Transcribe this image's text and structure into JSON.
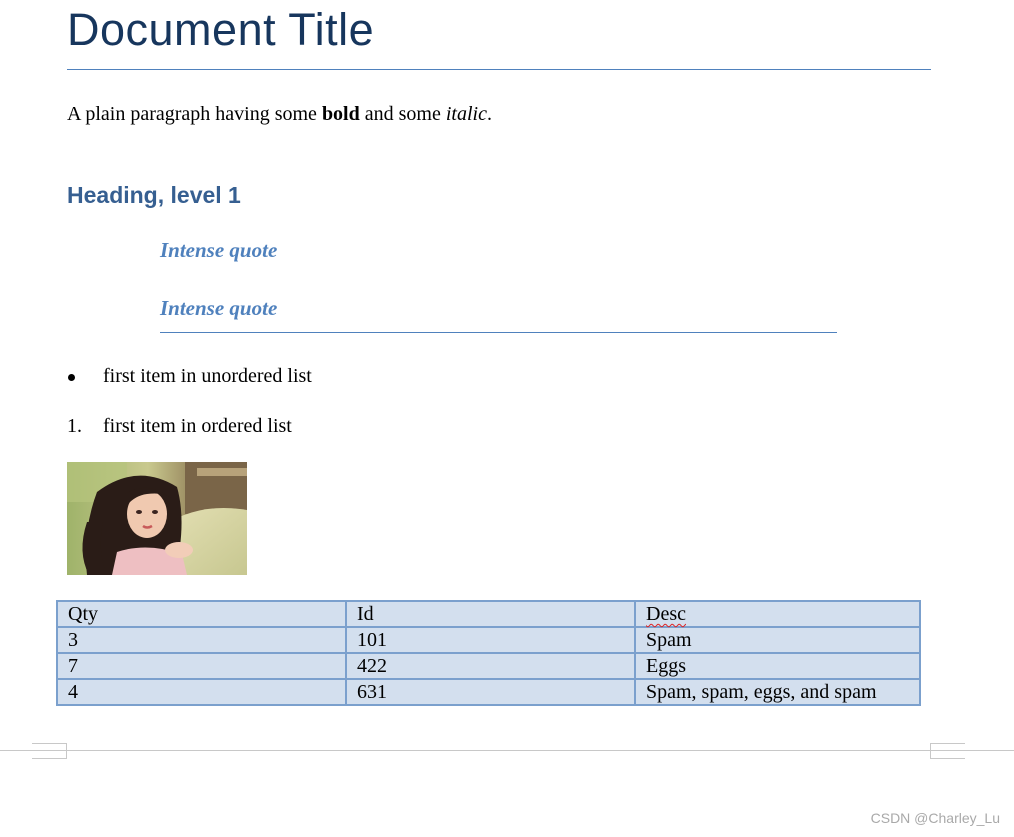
{
  "document": {
    "title": "Document Title",
    "paragraph": {
      "plain": "A plain paragraph having some ",
      "bold": "bold",
      "middle": " and some ",
      "italic": "italic",
      "end": "."
    },
    "heading1": "Heading, level 1",
    "intense_quotes": [
      "Intense quote",
      "Intense quote"
    ],
    "unordered_list": [
      {
        "marker": "bullet",
        "text": "first item in unordered list"
      }
    ],
    "ordered_list": [
      {
        "marker": "1.",
        "text": "first item in ordered list"
      }
    ],
    "image": {
      "subject": "portrait photo of a woman with long dark hair"
    },
    "table": {
      "headers": [
        "Qty",
        "Id",
        "Desc"
      ],
      "rows": [
        [
          "3",
          "101",
          "Spam"
        ],
        [
          "7",
          "422",
          "Eggs"
        ],
        [
          "4",
          "631",
          "Spam, spam, eggs, and spam"
        ]
      ],
      "spellcheck_flagged": "Desc"
    }
  },
  "watermark": "CSDN @Charley_Lu",
  "colors": {
    "title": "#17365d",
    "title_rule": "#4f81bd",
    "heading": "#365f91",
    "quote": "#4f81bd",
    "table_fill": "#d3dfee",
    "table_border": "#7ba0cd",
    "spellcheck_underline": "#e02020",
    "watermark": "#a9a9a9"
  }
}
